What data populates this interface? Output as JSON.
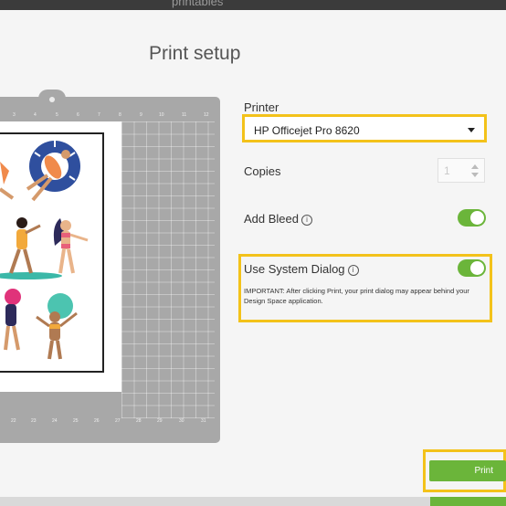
{
  "topbar": {
    "title": "printables"
  },
  "page": {
    "title": "Print setup"
  },
  "mat": {
    "ruler_numbers": [
      "3",
      "4",
      "5",
      "6",
      "7",
      "8",
      "9",
      "10",
      "11",
      "12"
    ],
    "bottom_numbers": [
      "22",
      "23",
      "24",
      "25",
      "26",
      "27",
      "28",
      "29",
      "30",
      "31"
    ]
  },
  "printer": {
    "label": "Printer",
    "selected": "HP Officejet Pro 8620"
  },
  "copies": {
    "label": "Copies",
    "value": "1"
  },
  "bleed": {
    "label": "Add Bleed",
    "info": "i",
    "enabled": true
  },
  "system_dialog": {
    "label": "Use System Dialog",
    "info": "i",
    "enabled": true,
    "note": "IMPORTANT: After clicking Print, your print dialog may appear behind your Design Space application."
  },
  "actions": {
    "print_label": "Print"
  },
  "colors": {
    "accent_green": "#6bb53a",
    "highlight_yellow": "#f3c21a"
  }
}
